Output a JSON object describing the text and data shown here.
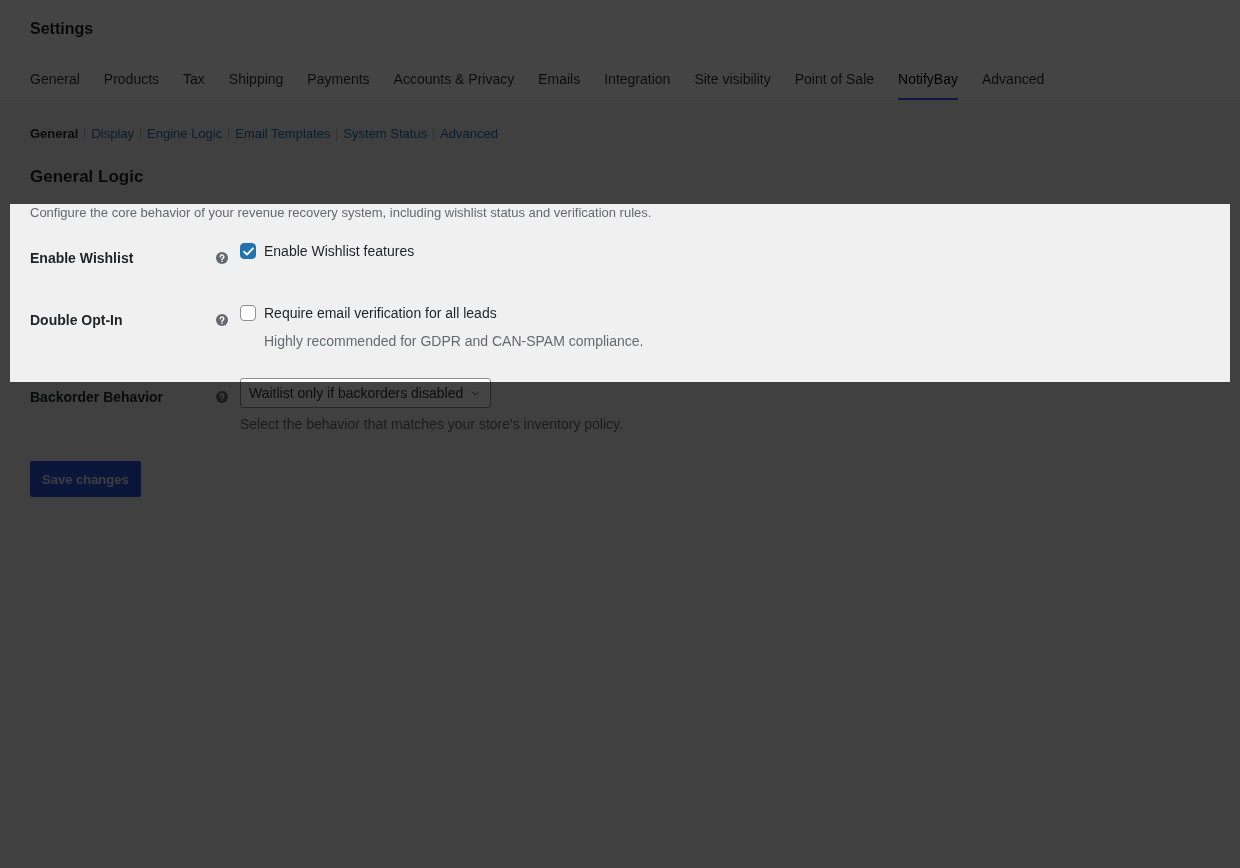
{
  "header": {
    "title": "Settings",
    "tabs": [
      {
        "label": "General",
        "selected": false
      },
      {
        "label": "Products",
        "selected": false
      },
      {
        "label": "Tax",
        "selected": false
      },
      {
        "label": "Shipping",
        "selected": false
      },
      {
        "label": "Payments",
        "selected": false
      },
      {
        "label": "Accounts & Privacy",
        "selected": false
      },
      {
        "label": "Emails",
        "selected": false
      },
      {
        "label": "Integration",
        "selected": false
      },
      {
        "label": "Site visibility",
        "selected": false
      },
      {
        "label": "Point of Sale",
        "selected": false
      },
      {
        "label": "NotifyBay",
        "selected": true
      },
      {
        "label": "Advanced",
        "selected": false
      }
    ]
  },
  "subnav": [
    {
      "label": "General",
      "selected": true
    },
    {
      "label": "Display",
      "selected": false
    },
    {
      "label": "Engine Logic",
      "selected": false
    },
    {
      "label": "Email Templates",
      "selected": false
    },
    {
      "label": "System Status",
      "selected": false
    },
    {
      "label": "Advanced",
      "selected": false
    }
  ],
  "section": {
    "title": "General Logic",
    "description": {
      "text": "Configure the core behavior of your revenue recovery system, including wishlist status and verification rules.",
      "highlighted": true
    }
  },
  "fields": [
    {
      "kind": "checkbox",
      "label": "Enable Wishlist",
      "checkbox_label": "Enable Wishlist features",
      "checked": true,
      "highlighted": true
    },
    {
      "kind": "checkbox",
      "label": "Double Opt-In",
      "checkbox_label": "Require email verification for all leads",
      "checked": false,
      "description": "Highly recommended for GDPR and CAN-SPAM compliance.",
      "highlighted": true
    },
    {
      "kind": "select",
      "label": "Backorder Behavior",
      "value": "Waitlist only if backorders disabled",
      "description": "Select the behavior that matches your store's inventory policy.",
      "highlighted": false
    }
  ],
  "save_button": {
    "label": "Save changes",
    "disabled": true
  }
}
